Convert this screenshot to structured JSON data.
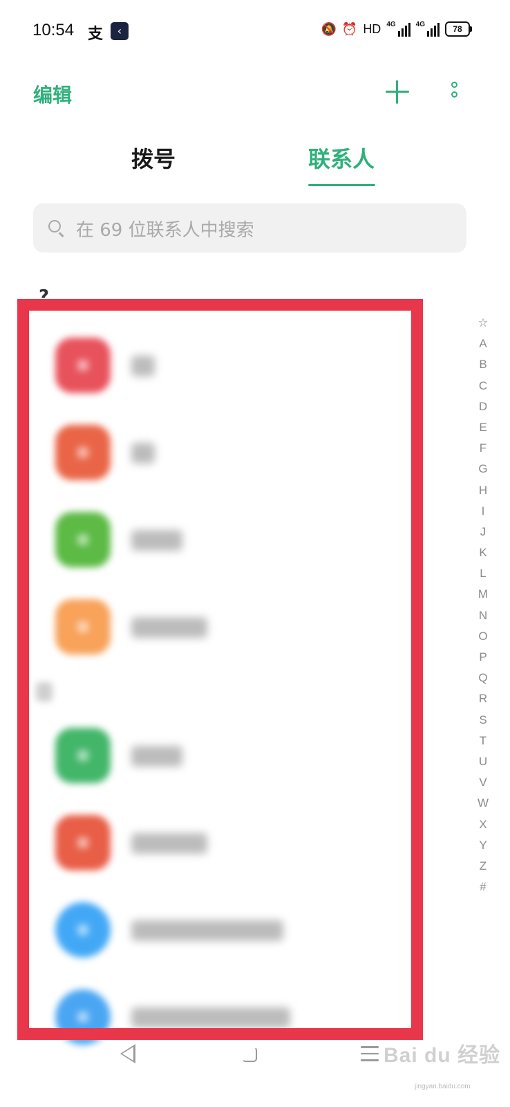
{
  "status_bar": {
    "time": "10:54",
    "app_icon_1": "支",
    "app_icon_2": "‹",
    "hd": "HD",
    "net1": "4G",
    "net2": "4G",
    "battery": "78"
  },
  "header": {
    "edit_label": "编辑",
    "add_icon": "plus-icon",
    "more_icon": "more-vertical-icon"
  },
  "tabs": [
    {
      "label": "拨号",
      "active": false
    },
    {
      "label": "联系人",
      "active": true
    }
  ],
  "search": {
    "placeholder": "在 69 位联系人中搜索"
  },
  "contacts": {
    "section_letter": "?",
    "avatar_colors": [
      "#e8525c",
      "#ea6547",
      "#5cba45",
      "#f8a25a",
      "#43b66a",
      "#e85e47",
      "#42a8f6",
      "#4aa6f3"
    ]
  },
  "alphabet_index": [
    "☆",
    "A",
    "B",
    "C",
    "D",
    "E",
    "F",
    "G",
    "H",
    "I",
    "J",
    "K",
    "L",
    "M",
    "N",
    "O",
    "P",
    "Q",
    "R",
    "S",
    "T",
    "U",
    "V",
    "W",
    "X",
    "Y",
    "Z",
    "#"
  ],
  "watermark": {
    "text": "Bai du 经验",
    "sub": "jingyan.baidu.com"
  },
  "colors": {
    "accent": "#2fb07a",
    "annotation": "#e8364a"
  }
}
